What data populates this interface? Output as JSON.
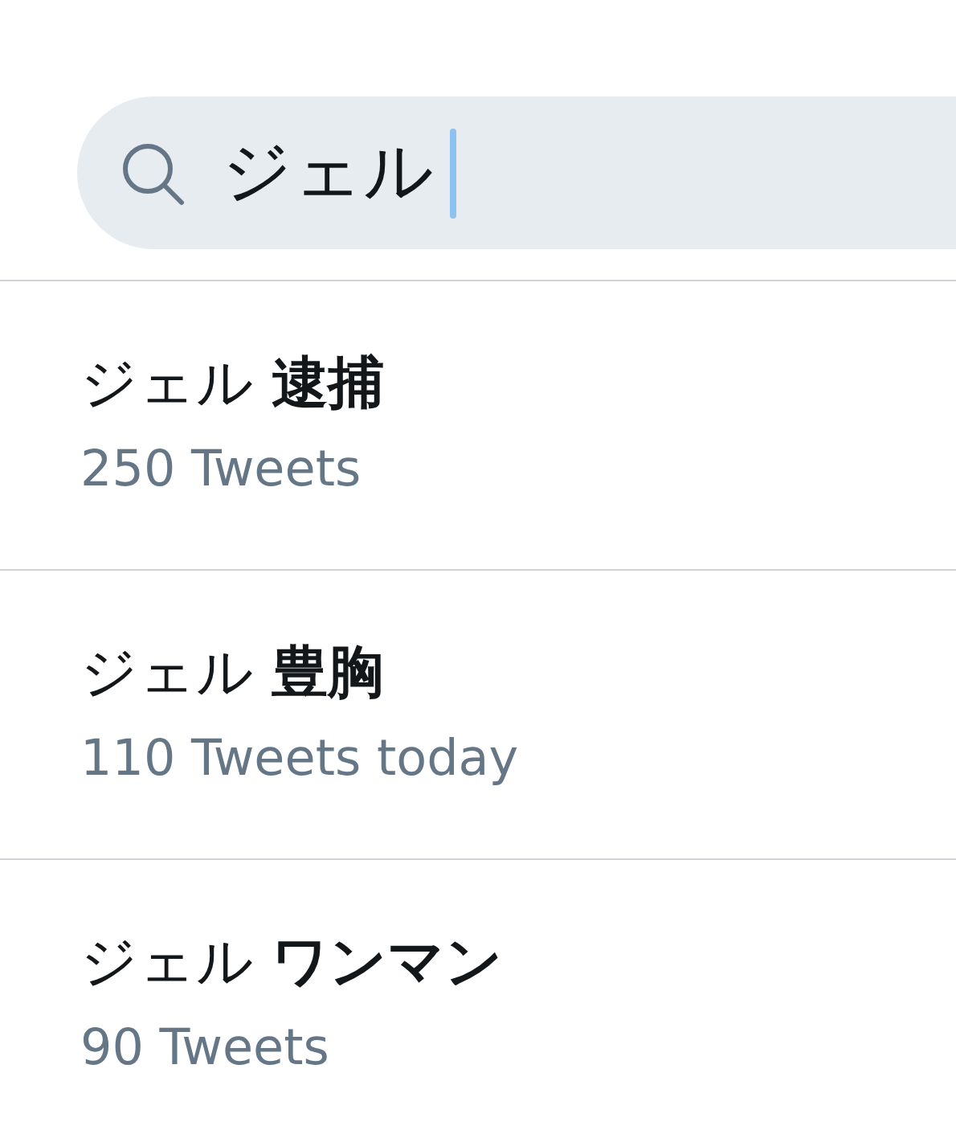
{
  "search": {
    "value": "ジェル",
    "focused": true
  },
  "suggestions": [
    {
      "title": "ジェル **逮捕**",
      "subtitle": "250 Tweets"
    },
    {
      "title": "ジェル **豊胸**",
      "subtitle": "110 Tweets today"
    },
    {
      "title": "ジェル **ワンマン**",
      "subtitle": "90 Tweets"
    }
  ]
}
